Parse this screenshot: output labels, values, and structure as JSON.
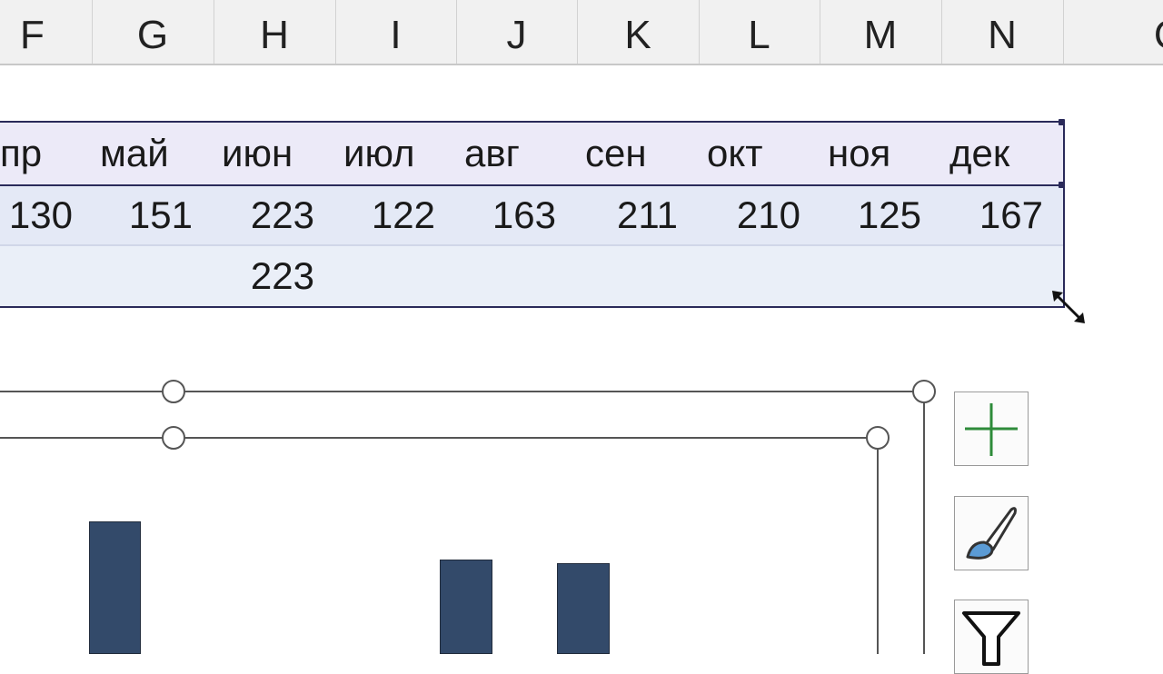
{
  "column_headers": [
    "F",
    "G",
    "H",
    "I",
    "J",
    "K",
    "L",
    "M",
    "N",
    "O"
  ],
  "table": {
    "months": [
      "пр",
      "май",
      "июн",
      "июл",
      "авг",
      "сен",
      "окт",
      "ноя",
      "дек"
    ],
    "values": [
      "130",
      "151",
      "223",
      "122",
      "163",
      "211",
      "210",
      "125",
      "167"
    ],
    "max_row": [
      "",
      "",
      "223",
      "",
      "",
      "",
      "",
      "",
      ""
    ]
  },
  "chart_buttons": {
    "add_element": "plus-icon",
    "styles": "brush-icon",
    "filters": "filter-icon"
  },
  "colors": {
    "bar": "#334a6a",
    "table_border": "#2a2a5a",
    "plus_green": "#2e8b3a"
  }
}
